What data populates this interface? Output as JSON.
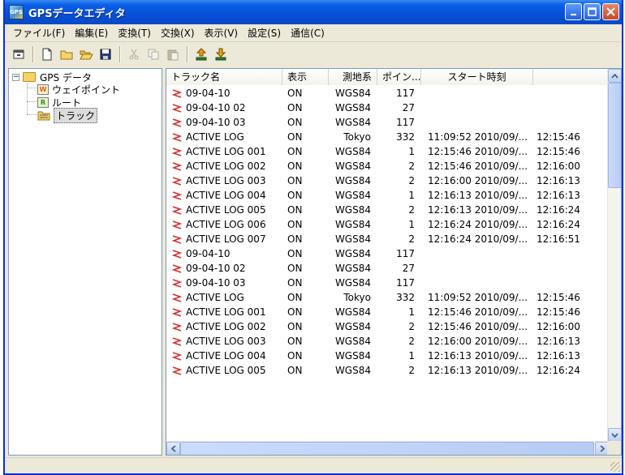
{
  "window": {
    "title": "GPSデータエディタ",
    "app_icon": "app-logo-icon",
    "controls": [
      "minimize-icon",
      "maximize-icon",
      "close-icon"
    ]
  },
  "menu": [
    {
      "label": "ファイル(F)"
    },
    {
      "label": "編集(E)"
    },
    {
      "label": "変換(T)"
    },
    {
      "label": "交換(X)"
    },
    {
      "label": "表示(V)"
    },
    {
      "label": "設定(S)"
    },
    {
      "label": "通信(C)"
    }
  ],
  "toolbar": {
    "buttons": [
      {
        "name": "collapse-icon",
        "enabled": true
      },
      {
        "name": "new-file-icon",
        "enabled": true
      },
      {
        "name": "new-folder-icon",
        "enabled": true
      },
      {
        "name": "open-folder-icon",
        "enabled": true
      },
      {
        "name": "save-icon",
        "enabled": true
      },
      {
        "name": "cut-icon",
        "enabled": false
      },
      {
        "name": "copy-icon",
        "enabled": false
      },
      {
        "name": "paste-icon",
        "enabled": false
      },
      {
        "name": "upload-icon",
        "enabled": true
      },
      {
        "name": "download-icon",
        "enabled": true
      }
    ]
  },
  "tree": {
    "root": {
      "label": "GPS データ",
      "expanded": true
    },
    "children": [
      {
        "label": "ウェイポイント",
        "icon_letter": "W",
        "icon_color": "#e05a1a",
        "selected": false
      },
      {
        "label": "ルート",
        "icon_letter": "R",
        "icon_color": "#2f8a2f",
        "selected": false
      },
      {
        "label": "トラック",
        "icon_letter": "",
        "icon_color": "#e0b030",
        "selected": true
      }
    ]
  },
  "grid": {
    "columns": [
      "トラック名",
      "表示",
      "測地系",
      "ポイン...",
      "スタート時刻",
      ""
    ],
    "rows": [
      {
        "name": "09-04-10",
        "display": "ON",
        "datum": "WGS84",
        "points": "117",
        "start": "",
        "end": ""
      },
      {
        "name": "09-04-10 02",
        "display": "ON",
        "datum": "WGS84",
        "points": "27",
        "start": "",
        "end": ""
      },
      {
        "name": "09-04-10 03",
        "display": "ON",
        "datum": "WGS84",
        "points": "117",
        "start": "",
        "end": ""
      },
      {
        "name": "ACTIVE LOG",
        "display": "ON",
        "datum": "Tokyo",
        "points": "332",
        "start": "11:09:52 2010/09/...",
        "end": "12:15:46"
      },
      {
        "name": "ACTIVE LOG 001",
        "display": "ON",
        "datum": "WGS84",
        "points": "1",
        "start": "12:15:46 2010/09/...",
        "end": "12:15:46"
      },
      {
        "name": "ACTIVE LOG 002",
        "display": "ON",
        "datum": "WGS84",
        "points": "2",
        "start": "12:15:46 2010/09/...",
        "end": "12:16:00"
      },
      {
        "name": "ACTIVE LOG 003",
        "display": "ON",
        "datum": "WGS84",
        "points": "2",
        "start": "12:16:00 2010/09/...",
        "end": "12:16:13"
      },
      {
        "name": "ACTIVE LOG 004",
        "display": "ON",
        "datum": "WGS84",
        "points": "1",
        "start": "12:16:13 2010/09/...",
        "end": "12:16:13"
      },
      {
        "name": "ACTIVE LOG 005",
        "display": "ON",
        "datum": "WGS84",
        "points": "2",
        "start": "12:16:13 2010/09/...",
        "end": "12:16:24"
      },
      {
        "name": "ACTIVE LOG 006",
        "display": "ON",
        "datum": "WGS84",
        "points": "1",
        "start": "12:16:24 2010/09/...",
        "end": "12:16:24"
      },
      {
        "name": "ACTIVE LOG 007",
        "display": "ON",
        "datum": "WGS84",
        "points": "2",
        "start": "12:16:24 2010/09/...",
        "end": "12:16:51"
      },
      {
        "name": "09-04-10",
        "display": "ON",
        "datum": "WGS84",
        "points": "117",
        "start": "",
        "end": ""
      },
      {
        "name": "09-04-10 02",
        "display": "ON",
        "datum": "WGS84",
        "points": "27",
        "start": "",
        "end": ""
      },
      {
        "name": "09-04-10 03",
        "display": "ON",
        "datum": "WGS84",
        "points": "117",
        "start": "",
        "end": ""
      },
      {
        "name": "ACTIVE LOG",
        "display": "ON",
        "datum": "Tokyo",
        "points": "332",
        "start": "11:09:52 2010/09/...",
        "end": "12:15:46"
      },
      {
        "name": "ACTIVE LOG 001",
        "display": "ON",
        "datum": "WGS84",
        "points": "1",
        "start": "12:15:46 2010/09/...",
        "end": "12:15:46"
      },
      {
        "name": "ACTIVE LOG 002",
        "display": "ON",
        "datum": "WGS84",
        "points": "2",
        "start": "12:15:46 2010/09/...",
        "end": "12:16:00"
      },
      {
        "name": "ACTIVE LOG 003",
        "display": "ON",
        "datum": "WGS84",
        "points": "2",
        "start": "12:16:00 2010/09/...",
        "end": "12:16:13"
      },
      {
        "name": "ACTIVE LOG 004",
        "display": "ON",
        "datum": "WGS84",
        "points": "1",
        "start": "12:16:13 2010/09/...",
        "end": "12:16:13"
      },
      {
        "name": "ACTIVE LOG 005",
        "display": "ON",
        "datum": "WGS84",
        "points": "2",
        "start": "12:16:13 2010/09/...",
        "end": "12:16:24"
      }
    ]
  },
  "colors": {
    "title_bar": "#0550d8",
    "track_icon": "#d43030",
    "selection_bg": "#dcdcdc"
  }
}
